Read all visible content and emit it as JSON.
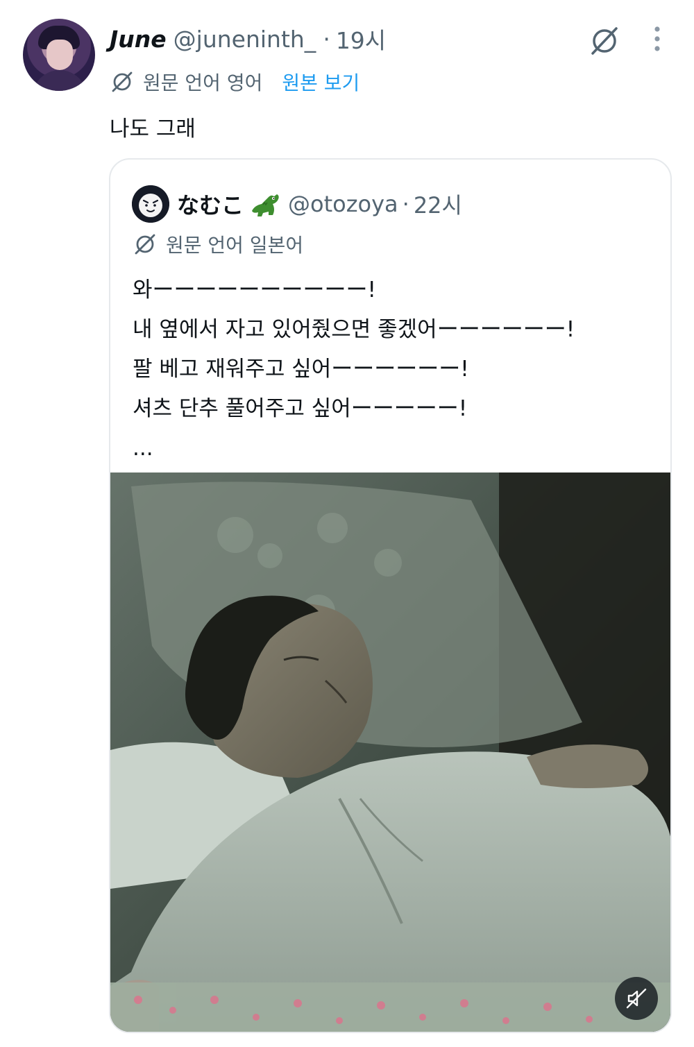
{
  "tweet": {
    "display_name": "June",
    "handle": "@juneninth_",
    "separator": "·",
    "time": "19시",
    "translation_label": "원문 언어 영어",
    "show_original": "원본 보기",
    "text": "나도 그래"
  },
  "icons": {
    "translate": "translate-off-icon",
    "more": "more-vertical-icon",
    "mute": "mute-icon",
    "crocodile": "crocodile-emoji-icon"
  },
  "quote": {
    "display_name": "なむこ",
    "handle": "@otozoya",
    "separator": "·",
    "time": "22시",
    "translation_label": "원문 언어 일본어",
    "lines": [
      "와ーーーーーーーーーー!",
      "내 옆에서 자고 있어줬으면 좋겠어ーーーーーー!",
      "팔 베고 재워주고 싶어ーーーーーー!",
      "셔츠 단추 풀어주고 싶어ーーーーー!",
      "..."
    ]
  },
  "colors": {
    "text_primary": "#0f1419",
    "text_secondary": "#536471",
    "link": "#1d9bf0",
    "border": "#e6e9ec"
  }
}
